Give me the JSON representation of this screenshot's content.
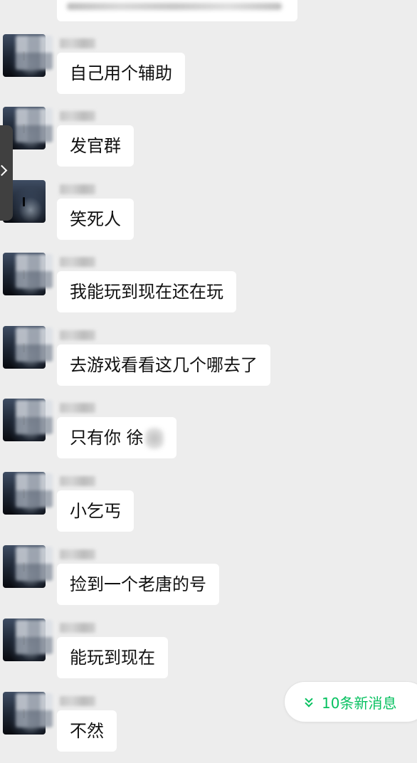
{
  "new_messages": {
    "label": "10条新消息"
  },
  "messages": [
    {
      "text": "自己用个辅助"
    },
    {
      "text": "发官群"
    },
    {
      "text": "笑死人"
    },
    {
      "text": "我能玩到现在还在玩"
    },
    {
      "text": "去游戏看看这几个哪去了"
    },
    {
      "text": "只有你 徐"
    },
    {
      "text": "小乞丐"
    },
    {
      "text": "捡到一个老唐的号"
    },
    {
      "text": "能玩到现在"
    },
    {
      "text": "不然"
    }
  ],
  "colors": {
    "background": "#ededed",
    "bubble": "#ffffff",
    "accent_green": "#07c160",
    "text": "#111111"
  },
  "icons": {
    "side_tab": "chevron-right-icon",
    "new_messages": "double-chevron-down-icon"
  }
}
